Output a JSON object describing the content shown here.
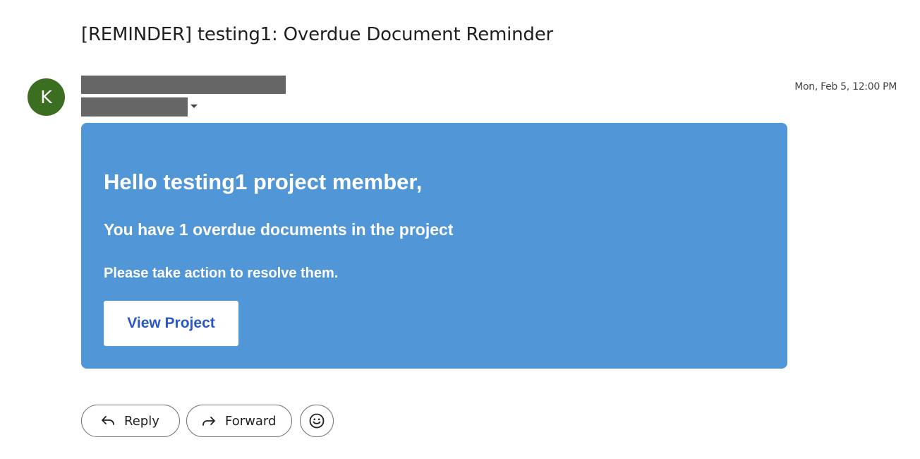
{
  "email": {
    "subject": "[REMINDER] testing1: Overdue Document Reminder",
    "sender_initial": "K",
    "timestamp": "Mon, Feb 5, 12:00 PM"
  },
  "body": {
    "greeting": "Hello testing1 project member,",
    "overdue_line": "You have 1 overdue documents in the project",
    "action_line": "Please take action to resolve them.",
    "cta_label": "View Project"
  },
  "actions": {
    "reply_label": "Reply",
    "forward_label": "Forward",
    "reply_icon": "reply-arrow-icon",
    "forward_icon": "forward-arrow-icon",
    "emoji_icon": "smiley-icon"
  },
  "colors": {
    "card_background": "#5196d6",
    "cta_text": "#2a57c5",
    "avatar_background": "#3c6e22",
    "redaction": "#666666"
  }
}
